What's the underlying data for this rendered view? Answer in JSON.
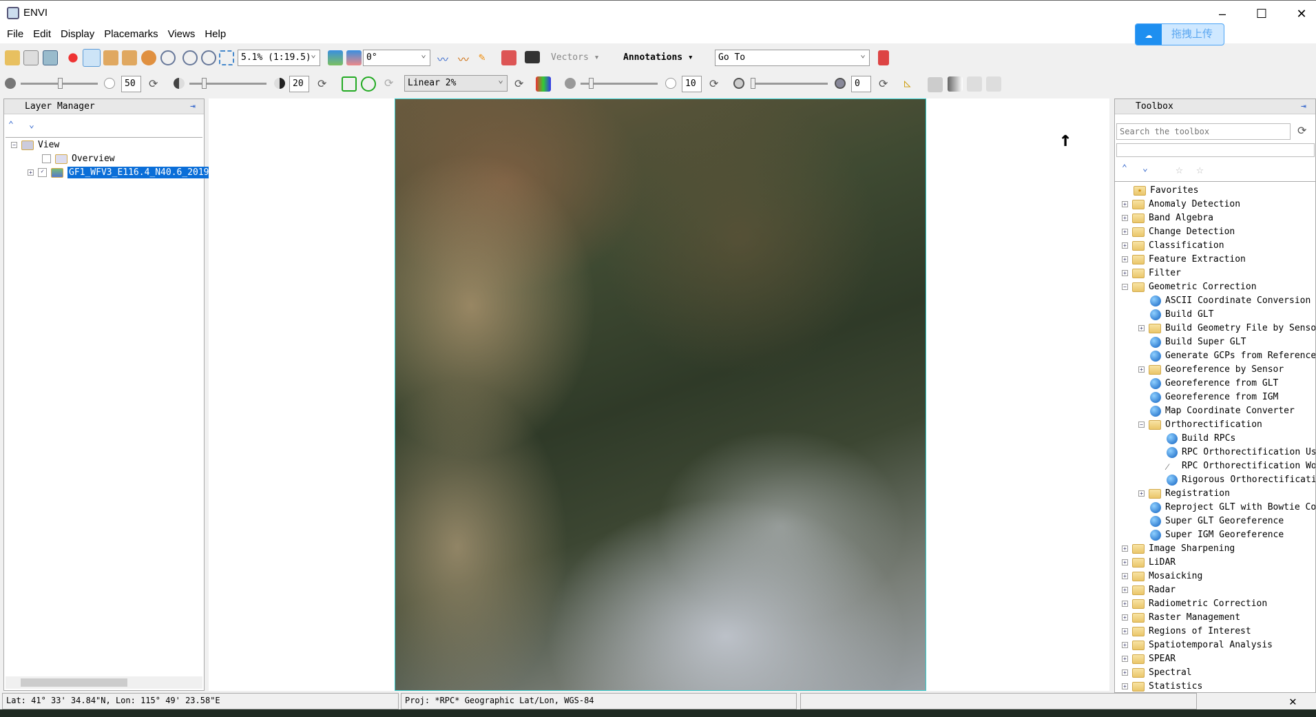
{
  "window": {
    "title": "ENVI",
    "minimize": "–",
    "maximize": "☐",
    "close": "✕"
  },
  "menu": [
    "File",
    "Edit",
    "Display",
    "Placemarks",
    "Views",
    "Help"
  ],
  "upload_button": {
    "label": "拖拽上传"
  },
  "toolbar1": {
    "zoom_value": "5.1% (1:19.5)",
    "rotation_value": "0°",
    "vectors_label": "Vectors ▾",
    "annotations_label": "Annotations ▾",
    "goto_value": "Go To"
  },
  "toolbar2": {
    "brightness": "50",
    "contrast": "20",
    "stretch": "Linear 2%",
    "sharpen": "10",
    "transparency": "0"
  },
  "layer_manager": {
    "title": "Layer Manager",
    "items": [
      {
        "label": "View"
      },
      {
        "label": "Overview"
      },
      {
        "label": "GF1_WFV3_E116.4_N40.6_2019"
      }
    ]
  },
  "toolbox": {
    "title": "Toolbox",
    "search_placeholder": "Search the toolbox",
    "items": [
      {
        "label": "Favorites",
        "level": 0,
        "type": "fav"
      },
      {
        "label": "Anomaly Detection",
        "level": 0,
        "type": "folder"
      },
      {
        "label": "Band Algebra",
        "level": 0,
        "type": "folder"
      },
      {
        "label": "Change Detection",
        "level": 0,
        "type": "folder"
      },
      {
        "label": "Classification",
        "level": 0,
        "type": "folder"
      },
      {
        "label": "Feature Extraction",
        "level": 0,
        "type": "folder"
      },
      {
        "label": "Filter",
        "level": 0,
        "type": "folder"
      },
      {
        "label": "Geometric Correction",
        "level": 0,
        "type": "open"
      },
      {
        "label": "ASCII Coordinate Conversion",
        "level": 1,
        "type": "tool"
      },
      {
        "label": "Build GLT",
        "level": 1,
        "type": "tool"
      },
      {
        "label": "Build Geometry File by Sensor",
        "level": 1,
        "type": "folder"
      },
      {
        "label": "Build Super GLT",
        "level": 1,
        "type": "tool"
      },
      {
        "label": "Generate GCPs from Reference",
        "level": 1,
        "type": "tool"
      },
      {
        "label": "Georeference by Sensor",
        "level": 1,
        "type": "folder"
      },
      {
        "label": "Georeference from GLT",
        "level": 1,
        "type": "tool"
      },
      {
        "label": "Georeference from IGM",
        "level": 1,
        "type": "tool"
      },
      {
        "label": "Map Coordinate Converter",
        "level": 1,
        "type": "tool"
      },
      {
        "label": "Orthorectification",
        "level": 1,
        "type": "open"
      },
      {
        "label": "Build RPCs",
        "level": 2,
        "type": "tool"
      },
      {
        "label": "RPC Orthorectification Using",
        "level": 2,
        "type": "tool"
      },
      {
        "label": "RPC Orthorectification Workflow",
        "level": 2,
        "type": "wand"
      },
      {
        "label": "Rigorous Orthorectification",
        "level": 2,
        "type": "tool"
      },
      {
        "label": "Registration",
        "level": 1,
        "type": "folder"
      },
      {
        "label": "Reproject GLT with Bowtie Correction",
        "level": 1,
        "type": "tool"
      },
      {
        "label": "Super GLT Georeference",
        "level": 1,
        "type": "tool"
      },
      {
        "label": "Super IGM Georeference",
        "level": 1,
        "type": "tool"
      },
      {
        "label": "Image Sharpening",
        "level": 0,
        "type": "folder"
      },
      {
        "label": "LiDAR",
        "level": 0,
        "type": "folder"
      },
      {
        "label": "Mosaicking",
        "level": 0,
        "type": "folder"
      },
      {
        "label": "Radar",
        "level": 0,
        "type": "folder"
      },
      {
        "label": "Radiometric Correction",
        "level": 0,
        "type": "folder"
      },
      {
        "label": "Raster Management",
        "level": 0,
        "type": "folder"
      },
      {
        "label": "Regions of Interest",
        "level": 0,
        "type": "folder"
      },
      {
        "label": "Spatiotemporal Analysis",
        "level": 0,
        "type": "folder"
      },
      {
        "label": "SPEAR",
        "level": 0,
        "type": "folder"
      },
      {
        "label": "Spectral",
        "level": 0,
        "type": "folder"
      },
      {
        "label": "Statistics",
        "level": 0,
        "type": "folder"
      }
    ]
  },
  "status": {
    "coords": "Lat: 41° 33' 34.84\"N, Lon: 115° 49' 23.58\"E",
    "projection": "Proj: *RPC* Geographic Lat/Lon, WGS-84",
    "extra": ""
  }
}
